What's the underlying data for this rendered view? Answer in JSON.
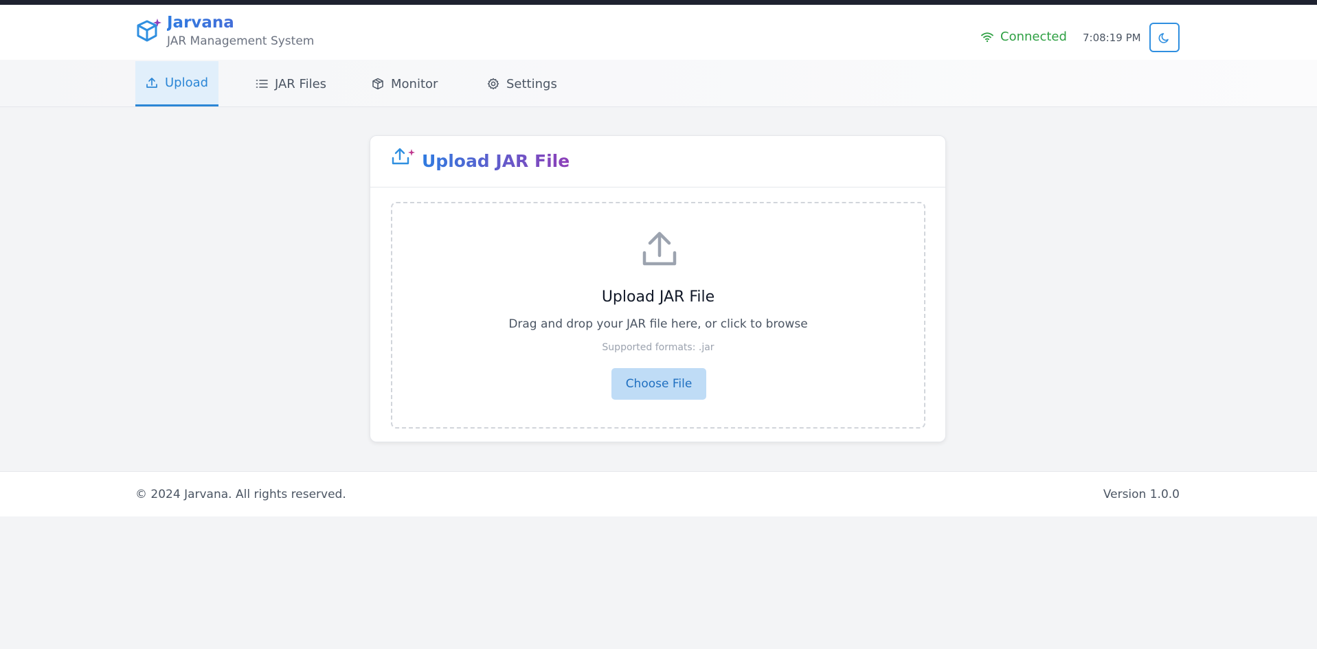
{
  "app": {
    "title": "Jarvana",
    "subtitle": "JAR Management System"
  },
  "header": {
    "connection_status": "Connected",
    "time": "7:08:19 PM",
    "theme_toggle_icon": "moon-icon"
  },
  "tabs": [
    {
      "label": "Upload",
      "icon": "upload-icon",
      "active": true
    },
    {
      "label": "JAR Files",
      "icon": "list-icon",
      "active": false
    },
    {
      "label": "Monitor",
      "icon": "package-icon",
      "active": false
    },
    {
      "label": "Settings",
      "icon": "gear-icon",
      "active": false
    }
  ],
  "upload_card": {
    "title": "Upload JAR File",
    "dropzone": {
      "title": "Upload JAR File",
      "description": "Drag and drop your JAR file here, or click to browse",
      "formats": "Supported formats: .jar",
      "button_label": "Choose File"
    }
  },
  "footer": {
    "copyright": "© 2024 Jarvana. All rights reserved.",
    "version": "Version 1.0.0"
  },
  "colors": {
    "accent": "#2b86d6",
    "connected": "#2ea043",
    "button_bg": "#bfdcf6"
  }
}
